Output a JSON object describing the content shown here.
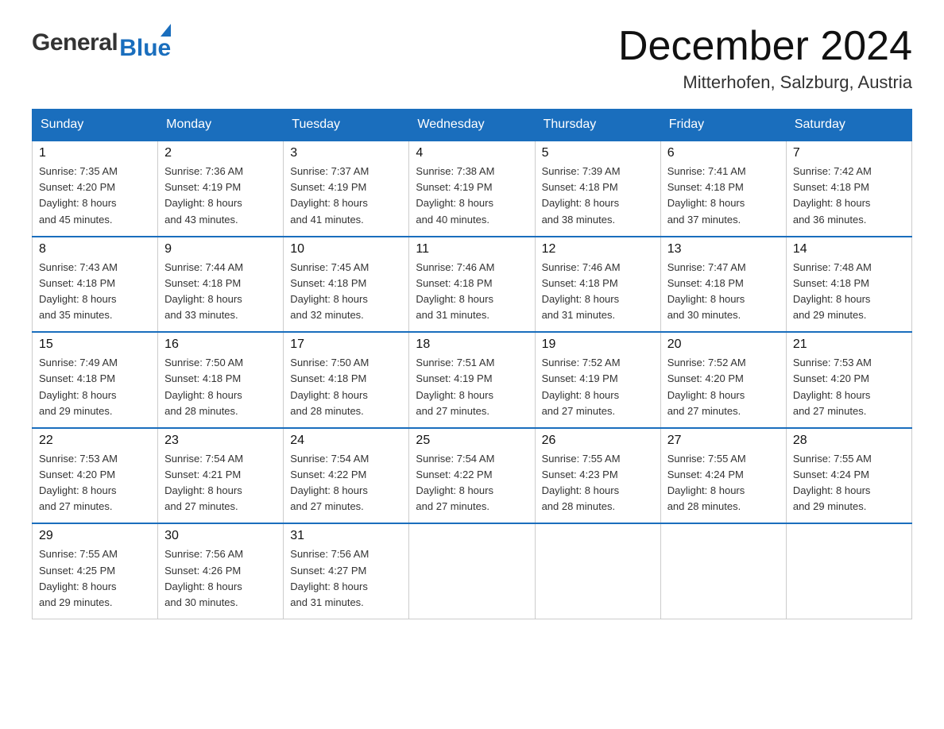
{
  "header": {
    "logo_general": "General",
    "logo_blue": "Blue",
    "month_title": "December 2024",
    "location": "Mitterhofen, Salzburg, Austria"
  },
  "weekdays": [
    "Sunday",
    "Monday",
    "Tuesday",
    "Wednesday",
    "Thursday",
    "Friday",
    "Saturday"
  ],
  "weeks": [
    [
      {
        "day": "1",
        "sunrise": "7:35 AM",
        "sunset": "4:20 PM",
        "daylight": "8 hours and 45 minutes."
      },
      {
        "day": "2",
        "sunrise": "7:36 AM",
        "sunset": "4:19 PM",
        "daylight": "8 hours and 43 minutes."
      },
      {
        "day": "3",
        "sunrise": "7:37 AM",
        "sunset": "4:19 PM",
        "daylight": "8 hours and 41 minutes."
      },
      {
        "day": "4",
        "sunrise": "7:38 AM",
        "sunset": "4:19 PM",
        "daylight": "8 hours and 40 minutes."
      },
      {
        "day": "5",
        "sunrise": "7:39 AM",
        "sunset": "4:18 PM",
        "daylight": "8 hours and 38 minutes."
      },
      {
        "day": "6",
        "sunrise": "7:41 AM",
        "sunset": "4:18 PM",
        "daylight": "8 hours and 37 minutes."
      },
      {
        "day": "7",
        "sunrise": "7:42 AM",
        "sunset": "4:18 PM",
        "daylight": "8 hours and 36 minutes."
      }
    ],
    [
      {
        "day": "8",
        "sunrise": "7:43 AM",
        "sunset": "4:18 PM",
        "daylight": "8 hours and 35 minutes."
      },
      {
        "day": "9",
        "sunrise": "7:44 AM",
        "sunset": "4:18 PM",
        "daylight": "8 hours and 33 minutes."
      },
      {
        "day": "10",
        "sunrise": "7:45 AM",
        "sunset": "4:18 PM",
        "daylight": "8 hours and 32 minutes."
      },
      {
        "day": "11",
        "sunrise": "7:46 AM",
        "sunset": "4:18 PM",
        "daylight": "8 hours and 31 minutes."
      },
      {
        "day": "12",
        "sunrise": "7:46 AM",
        "sunset": "4:18 PM",
        "daylight": "8 hours and 31 minutes."
      },
      {
        "day": "13",
        "sunrise": "7:47 AM",
        "sunset": "4:18 PM",
        "daylight": "8 hours and 30 minutes."
      },
      {
        "day": "14",
        "sunrise": "7:48 AM",
        "sunset": "4:18 PM",
        "daylight": "8 hours and 29 minutes."
      }
    ],
    [
      {
        "day": "15",
        "sunrise": "7:49 AM",
        "sunset": "4:18 PM",
        "daylight": "8 hours and 29 minutes."
      },
      {
        "day": "16",
        "sunrise": "7:50 AM",
        "sunset": "4:18 PM",
        "daylight": "8 hours and 28 minutes."
      },
      {
        "day": "17",
        "sunrise": "7:50 AM",
        "sunset": "4:18 PM",
        "daylight": "8 hours and 28 minutes."
      },
      {
        "day": "18",
        "sunrise": "7:51 AM",
        "sunset": "4:19 PM",
        "daylight": "8 hours and 27 minutes."
      },
      {
        "day": "19",
        "sunrise": "7:52 AM",
        "sunset": "4:19 PM",
        "daylight": "8 hours and 27 minutes."
      },
      {
        "day": "20",
        "sunrise": "7:52 AM",
        "sunset": "4:20 PM",
        "daylight": "8 hours and 27 minutes."
      },
      {
        "day": "21",
        "sunrise": "7:53 AM",
        "sunset": "4:20 PM",
        "daylight": "8 hours and 27 minutes."
      }
    ],
    [
      {
        "day": "22",
        "sunrise": "7:53 AM",
        "sunset": "4:20 PM",
        "daylight": "8 hours and 27 minutes."
      },
      {
        "day": "23",
        "sunrise": "7:54 AM",
        "sunset": "4:21 PM",
        "daylight": "8 hours and 27 minutes."
      },
      {
        "day": "24",
        "sunrise": "7:54 AM",
        "sunset": "4:22 PM",
        "daylight": "8 hours and 27 minutes."
      },
      {
        "day": "25",
        "sunrise": "7:54 AM",
        "sunset": "4:22 PM",
        "daylight": "8 hours and 27 minutes."
      },
      {
        "day": "26",
        "sunrise": "7:55 AM",
        "sunset": "4:23 PM",
        "daylight": "8 hours and 28 minutes."
      },
      {
        "day": "27",
        "sunrise": "7:55 AM",
        "sunset": "4:24 PM",
        "daylight": "8 hours and 28 minutes."
      },
      {
        "day": "28",
        "sunrise": "7:55 AM",
        "sunset": "4:24 PM",
        "daylight": "8 hours and 29 minutes."
      }
    ],
    [
      {
        "day": "29",
        "sunrise": "7:55 AM",
        "sunset": "4:25 PM",
        "daylight": "8 hours and 29 minutes."
      },
      {
        "day": "30",
        "sunrise": "7:56 AM",
        "sunset": "4:26 PM",
        "daylight": "8 hours and 30 minutes."
      },
      {
        "day": "31",
        "sunrise": "7:56 AM",
        "sunset": "4:27 PM",
        "daylight": "8 hours and 31 minutes."
      },
      null,
      null,
      null,
      null
    ]
  ],
  "labels": {
    "sunrise_prefix": "Sunrise: ",
    "sunset_prefix": "Sunset: ",
    "daylight_prefix": "Daylight: "
  }
}
